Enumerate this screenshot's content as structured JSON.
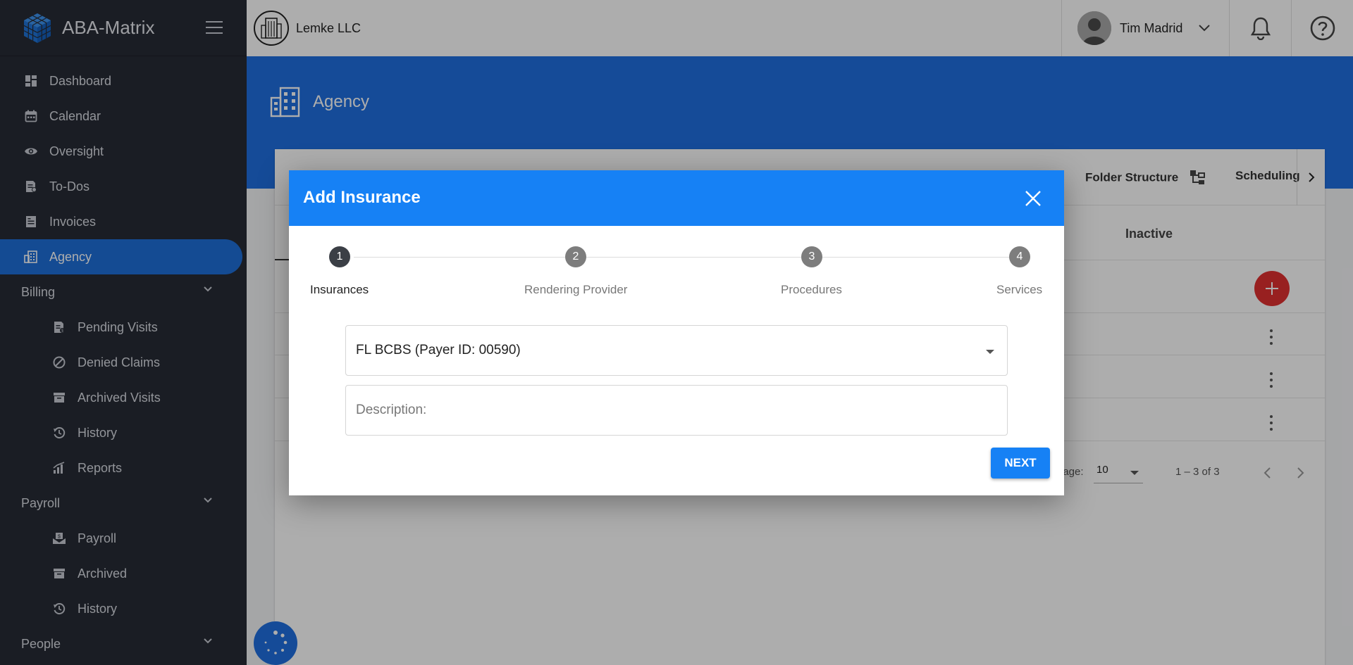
{
  "app": {
    "name": "ABA-Matrix"
  },
  "sidebar": {
    "items": [
      {
        "label": "Dashboard",
        "icon": "dashboard-icon"
      },
      {
        "label": "Calendar",
        "icon": "calendar-icon"
      },
      {
        "label": "Oversight",
        "icon": "eye-icon"
      },
      {
        "label": "To-Dos",
        "icon": "todo-icon"
      },
      {
        "label": "Invoices",
        "icon": "invoice-icon"
      },
      {
        "label": "Agency",
        "icon": "agency-icon",
        "active": true
      }
    ],
    "billing": {
      "label": "Billing",
      "items": [
        {
          "label": "Pending Visits",
          "icon": "pending-icon"
        },
        {
          "label": "Denied Claims",
          "icon": "denied-icon"
        },
        {
          "label": "Archived Visits",
          "icon": "archive-icon"
        },
        {
          "label": "History",
          "icon": "history-icon"
        },
        {
          "label": "Reports",
          "icon": "reports-icon"
        }
      ]
    },
    "payroll": {
      "label": "Payroll",
      "items": [
        {
          "label": "Payroll",
          "icon": "payroll-icon"
        },
        {
          "label": "Archived",
          "icon": "archive-icon"
        },
        {
          "label": "History",
          "icon": "history-icon"
        }
      ]
    },
    "people": {
      "label": "People"
    }
  },
  "header": {
    "company": "Lemke LLC",
    "user": "Tim Madrid"
  },
  "page": {
    "title": "Agency",
    "tabs": {
      "folder_structure": "Folder Structure",
      "scheduling": "Scheduling"
    },
    "column_inactive": "Inactive",
    "pager": {
      "per_page_label": "page:",
      "per_page_value": "10",
      "range": "1 – 3 of 3"
    }
  },
  "dialog": {
    "title": "Add Insurance",
    "steps": [
      {
        "number": "1",
        "label": "Insurances",
        "active": true
      },
      {
        "number": "2",
        "label": "Rendering Provider"
      },
      {
        "number": "3",
        "label": "Procedures"
      },
      {
        "number": "4",
        "label": "Services"
      }
    ],
    "insurance_select": {
      "value": "FL BCBS (Payer ID: 00590)"
    },
    "description": {
      "placeholder": "Description:",
      "value": ""
    },
    "next_label": "NEXT"
  },
  "colors": {
    "sidebar_bg": "#272c36",
    "accent": "#1f6fe0",
    "dialog_header": "#1681f5",
    "fab": "#e03030"
  }
}
